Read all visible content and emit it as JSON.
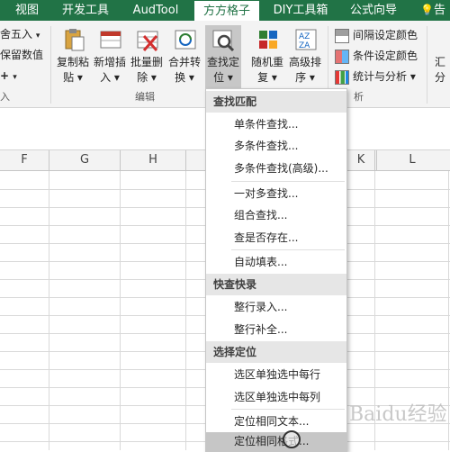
{
  "tabs": [
    {
      "label": "视图"
    },
    {
      "label": "开发工具"
    },
    {
      "label": "AudTool"
    },
    {
      "label": "方方格子"
    },
    {
      "label": "DIY工具箱"
    },
    {
      "label": "公式向导"
    },
    {
      "label": "告"
    }
  ],
  "ribbon": {
    "left_items": [
      "舍五入",
      "保留数值"
    ],
    "left_plus": "+",
    "left_group": "入",
    "buttons": [
      {
        "label": "复制粘贴",
        "line1": "复制粘",
        "line2": "贴 ▾"
      },
      {
        "label": "新增插入",
        "line1": "新增插",
        "line2": "入 ▾"
      },
      {
        "label": "批量删除",
        "line1": "批量删",
        "line2": "除 ▾"
      },
      {
        "label": "合并转换",
        "line1": "合并转",
        "line2": "换 ▾"
      },
      {
        "label": "查找定位",
        "line1": "查找定",
        "line2": "位 ▾"
      },
      {
        "label": "随机重复",
        "line1": "随机重",
        "line2": "复 ▾"
      },
      {
        "label": "高级排序",
        "line1": "高级排",
        "line2": "序 ▾"
      }
    ],
    "group_edit": "编辑",
    "right_items": [
      {
        "label": "间隔设定颜色"
      },
      {
        "label": "条件设定颜色"
      },
      {
        "label": "统计与分析 ▾"
      }
    ],
    "group_analysis": "析",
    "far_right_line1": "汇",
    "far_right_line2": "分"
  },
  "columns": [
    "F",
    "G",
    "H",
    "K",
    "L"
  ],
  "menu": {
    "sections": [
      {
        "header": "查找匹配",
        "items": [
          "单条件查找...",
          "多条件查找...",
          "多条件查找(高级)...",
          "一对多查找...",
          "组合查找...",
          "查是否存在...",
          "自动填表..."
        ]
      },
      {
        "header": "快查快录",
        "items": [
          "整行录入...",
          "整行补全..."
        ]
      },
      {
        "header": "选择定位",
        "items": [
          "选区单独选中每行",
          "选区单独选中每列",
          "定位相同文本...",
          "定位相同格式..."
        ]
      }
    ],
    "highlighted": "定位相同格式..."
  },
  "watermark": "Baidu经验",
  "colors": {
    "accent": "#217346",
    "ribbon_bg": "#f3f3f3",
    "menu_header": "#e6e6e6"
  }
}
